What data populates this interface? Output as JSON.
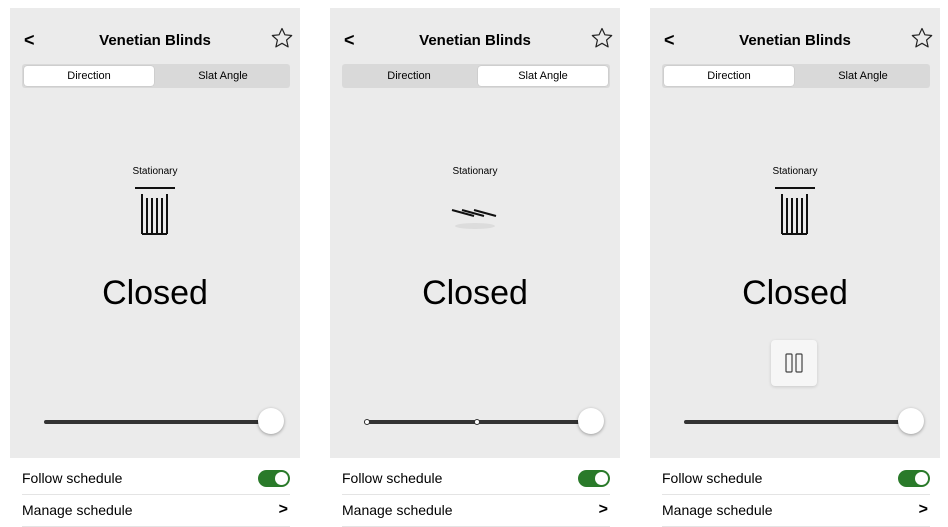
{
  "screens": [
    {
      "title": "Venetian Blinds",
      "tabs": [
        "Direction",
        "Slat Angle"
      ],
      "active_tab": "Direction",
      "status": "Stationary",
      "state": "Closed",
      "icon": "blind-closed-icon",
      "slider_value": 1.0,
      "schedule": {
        "follow_label": "Follow schedule",
        "follow_on": true,
        "manage_label": "Manage schedule"
      }
    },
    {
      "title": "Venetian Blinds",
      "tabs": [
        "Direction",
        "Slat Angle"
      ],
      "active_tab": "Slat Angle",
      "status": "Stationary",
      "state": "Closed",
      "icon": "slat-angle-icon",
      "slider_value": 1.0,
      "schedule": {
        "follow_label": "Follow schedule",
        "follow_on": true,
        "manage_label": "Manage schedule"
      }
    },
    {
      "title": "Venetian Blinds",
      "tabs": [
        "Direction",
        "Slat Angle"
      ],
      "active_tab": "Direction",
      "status": "Stationary",
      "state": "Closed",
      "icon": "blind-closed-icon",
      "slider_value": 1.0,
      "schedule": {
        "follow_label": "Follow schedule",
        "follow_on": true,
        "manage_label": "Manage schedule"
      }
    }
  ],
  "colors": {
    "panel": "#ebebeb",
    "toggle_on": "#2a7a2a"
  }
}
